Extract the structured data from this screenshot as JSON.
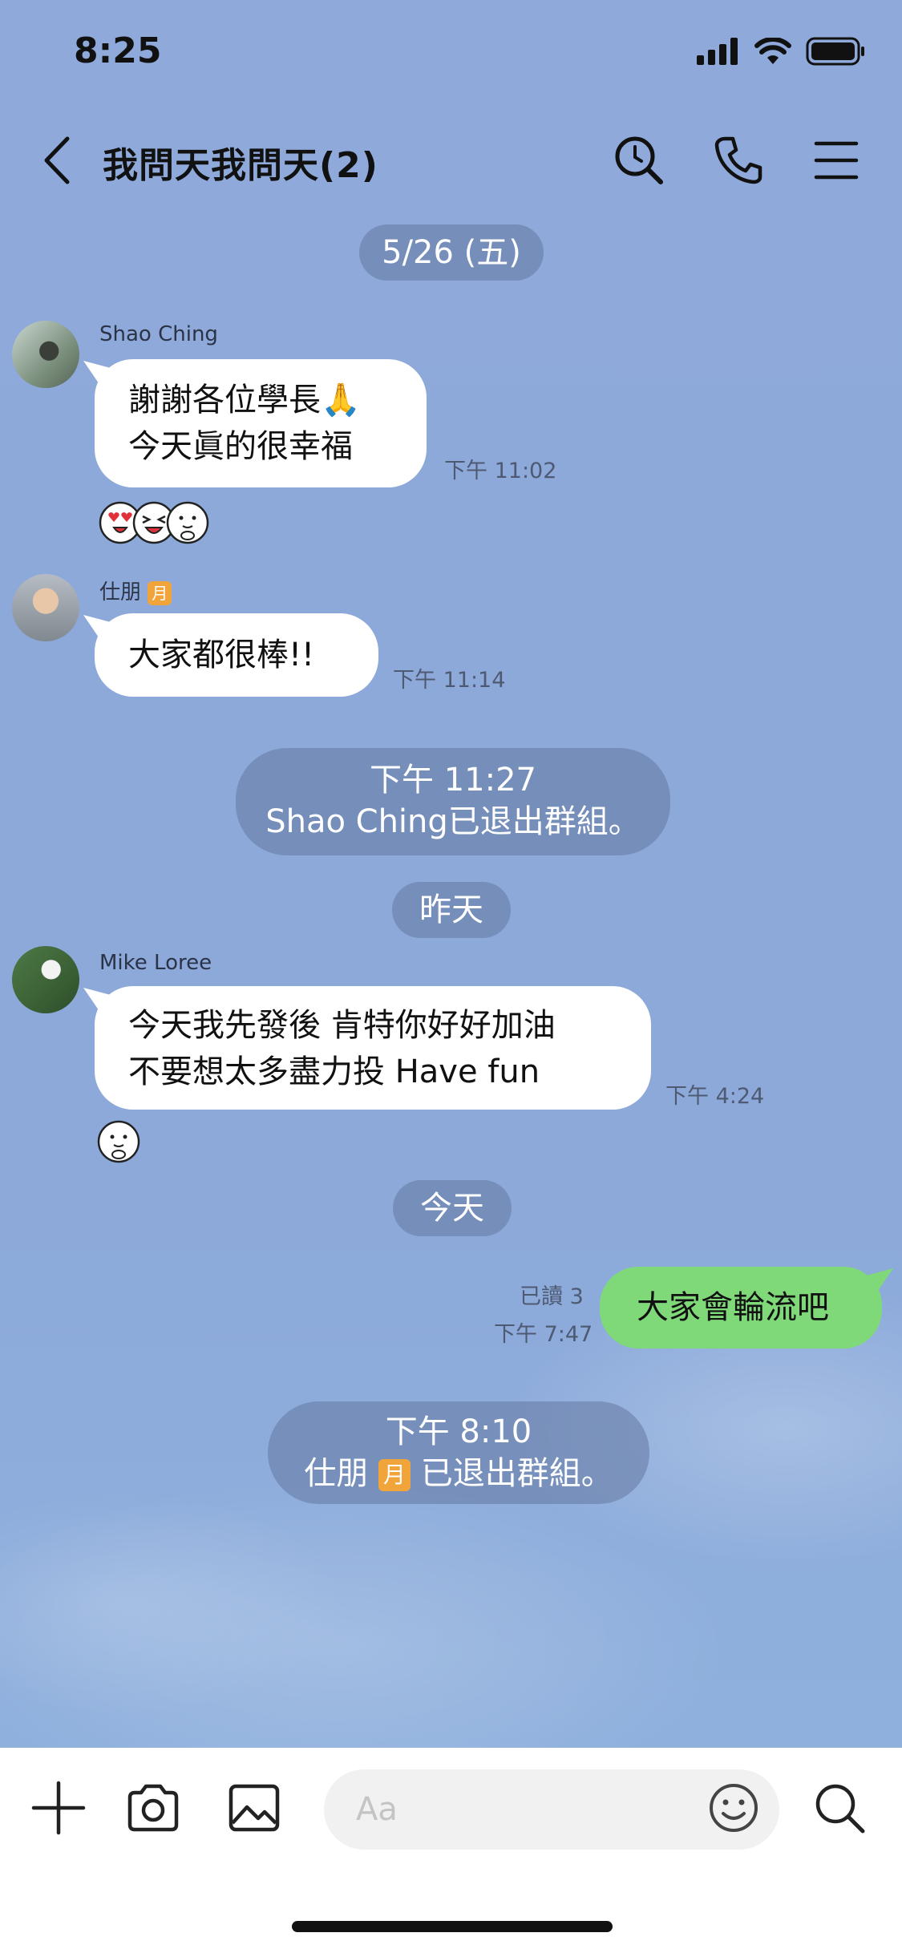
{
  "status_bar": {
    "time": "8:25"
  },
  "header": {
    "title": "我問天我問天(2)"
  },
  "date_pills": {
    "d1": "5/26 (五)",
    "d2": "昨天",
    "d3": "今天"
  },
  "messages": [
    {
      "sender": "Shao Ching",
      "lines": [
        "謝謝各位學長🙏",
        "今天眞的很幸福"
      ],
      "time": "下午 11:02"
    },
    {
      "sender": "仕朋",
      "sender_badge": "月",
      "lines": [
        "大家都很棒!!"
      ],
      "time": "下午 11:14"
    },
    {
      "sender": "Mike Loree",
      "lines": [
        "今天我先發後 肯特你好好加油",
        "不要想太多盡力投 Have fun"
      ],
      "time": "下午 4:24"
    },
    {
      "sender": "me",
      "lines": [
        "大家會輪流吧"
      ],
      "read": "已讀 3",
      "time": "下午 7:47"
    }
  ],
  "system": [
    {
      "time": "下午 11:27",
      "text": "Shao Ching已退出群組。"
    },
    {
      "time": "下午 8:10",
      "name": "仕朋",
      "badge": "月",
      "text": "已退出群組。"
    }
  ],
  "input": {
    "placeholder": "Aa"
  },
  "icons": {
    "back": "chevron-left-icon",
    "search": "search-icon",
    "call": "phone-icon",
    "menu": "hamburger-menu-icon",
    "plus": "plus-icon",
    "camera": "camera-icon",
    "image": "image-icon",
    "emoji": "smiley-icon"
  },
  "colors": {
    "background": "#8eabda",
    "my_bubble": "#7fd979",
    "their_bubble": "#ffffff"
  }
}
